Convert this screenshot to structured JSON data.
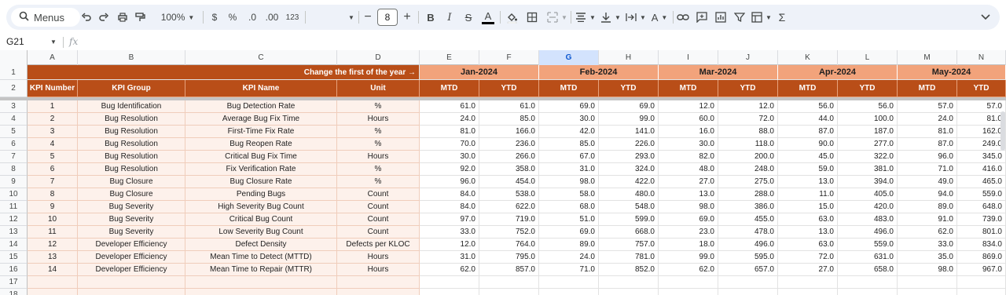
{
  "toolbar": {
    "menus_label": "Menus",
    "zoom": "100%",
    "currency": "$",
    "percent": "%",
    "decrease_decimal": ".0",
    "increase_decimal": ".00",
    "number_format": "123",
    "font_size": "8",
    "function_symbol": "Σ"
  },
  "formula_bar": {
    "cell_ref": "G21",
    "fx": "fx",
    "value": ""
  },
  "columns": [
    "A",
    "B",
    "C",
    "D",
    "E",
    "F",
    "G",
    "H",
    "I",
    "J",
    "K",
    "L",
    "M",
    "N"
  ],
  "selected_column": "G",
  "row_numbers": [
    "1",
    "2",
    "3",
    "4",
    "5",
    "6",
    "7",
    "8",
    "9",
    "10",
    "11",
    "12",
    "13",
    "14",
    "15",
    "16",
    "17",
    "18"
  ],
  "sheet": {
    "banner": "Change the first of the year →",
    "months": [
      "Jan-2024",
      "Feb-2024",
      "Mar-2024",
      "Apr-2024",
      "May-2024"
    ],
    "headers": [
      "KPI Number",
      "KPI Group",
      "KPI Name",
      "Unit"
    ],
    "mtd": "MTD",
    "ytd": "YTD",
    "rows": [
      [
        "1",
        "Bug Identification",
        "Bug Detection Rate",
        "%",
        "61.0",
        "61.0",
        "69.0",
        "69.0",
        "12.0",
        "12.0",
        "56.0",
        "56.0",
        "57.0",
        "57.0"
      ],
      [
        "2",
        "Bug Resolution",
        "Average Bug Fix Time",
        "Hours",
        "24.0",
        "85.0",
        "30.0",
        "99.0",
        "60.0",
        "72.0",
        "44.0",
        "100.0",
        "24.0",
        "81.0"
      ],
      [
        "3",
        "Bug Resolution",
        "First-Time Fix Rate",
        "%",
        "81.0",
        "166.0",
        "42.0",
        "141.0",
        "16.0",
        "88.0",
        "87.0",
        "187.0",
        "81.0",
        "162.0"
      ],
      [
        "4",
        "Bug Resolution",
        "Bug Reopen Rate",
        "%",
        "70.0",
        "236.0",
        "85.0",
        "226.0",
        "30.0",
        "118.0",
        "90.0",
        "277.0",
        "87.0",
        "249.0"
      ],
      [
        "5",
        "Bug Resolution",
        "Critical Bug Fix Time",
        "Hours",
        "30.0",
        "266.0",
        "67.0",
        "293.0",
        "82.0",
        "200.0",
        "45.0",
        "322.0",
        "96.0",
        "345.0"
      ],
      [
        "6",
        "Bug Resolution",
        "Fix Verification Rate",
        "%",
        "92.0",
        "358.0",
        "31.0",
        "324.0",
        "48.0",
        "248.0",
        "59.0",
        "381.0",
        "71.0",
        "416.0"
      ],
      [
        "7",
        "Bug Closure",
        "Bug Closure Rate",
        "%",
        "96.0",
        "454.0",
        "98.0",
        "422.0",
        "27.0",
        "275.0",
        "13.0",
        "394.0",
        "49.0",
        "465.0"
      ],
      [
        "8",
        "Bug Closure",
        "Pending Bugs",
        "Count",
        "84.0",
        "538.0",
        "58.0",
        "480.0",
        "13.0",
        "288.0",
        "11.0",
        "405.0",
        "94.0",
        "559.0"
      ],
      [
        "9",
        "Bug Severity",
        "High Severity Bug Count",
        "Count",
        "84.0",
        "622.0",
        "68.0",
        "548.0",
        "98.0",
        "386.0",
        "15.0",
        "420.0",
        "89.0",
        "648.0"
      ],
      [
        "10",
        "Bug Severity",
        "Critical Bug Count",
        "Count",
        "97.0",
        "719.0",
        "51.0",
        "599.0",
        "69.0",
        "455.0",
        "63.0",
        "483.0",
        "91.0",
        "739.0"
      ],
      [
        "11",
        "Bug Severity",
        "Low Severity Bug Count",
        "Count",
        "33.0",
        "752.0",
        "69.0",
        "668.0",
        "23.0",
        "478.0",
        "13.0",
        "496.0",
        "62.0",
        "801.0"
      ],
      [
        "12",
        "Developer Efficiency",
        "Defect Density",
        "Defects per KLOC",
        "12.0",
        "764.0",
        "89.0",
        "757.0",
        "18.0",
        "496.0",
        "63.0",
        "559.0",
        "33.0",
        "834.0"
      ],
      [
        "13",
        "Developer Efficiency",
        "Mean Time to Detect (MTTD)",
        "Hours",
        "31.0",
        "795.0",
        "24.0",
        "781.0",
        "99.0",
        "595.0",
        "72.0",
        "631.0",
        "35.0",
        "869.0"
      ],
      [
        "14",
        "Developer Efficiency",
        "Mean Time to Repair (MTTR)",
        "Hours",
        "62.0",
        "857.0",
        "71.0",
        "852.0",
        "62.0",
        "657.0",
        "27.0",
        "658.0",
        "98.0",
        "967.0"
      ]
    ]
  },
  "colors": {
    "dark_orange": "#b94e18",
    "light_orange": "#f2a37b",
    "pink_fill": "#fdf1eb"
  }
}
